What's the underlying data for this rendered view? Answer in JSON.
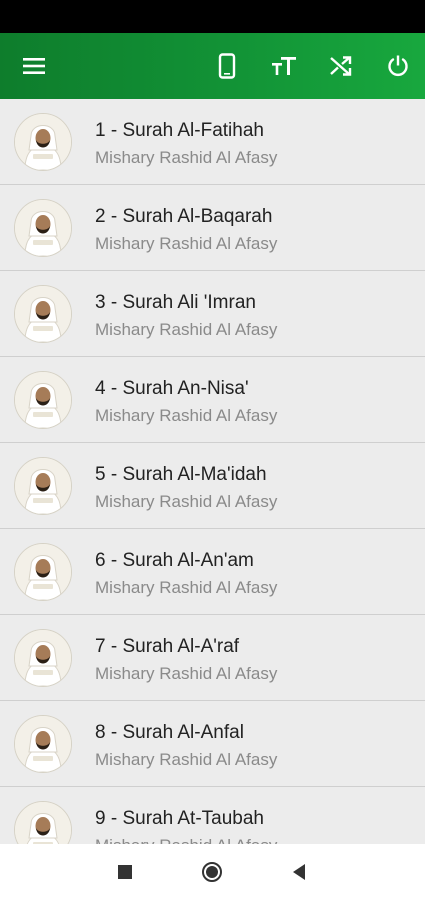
{
  "app_bar": {
    "icons": [
      "menu-icon",
      "phone-icon",
      "text-size-icon",
      "shuffle-icon",
      "power-icon"
    ],
    "color": "#129336"
  },
  "surahs": [
    {
      "title": "1 - Surah Al-Fatihah",
      "reciter": "Mishary Rashid Al Afasy"
    },
    {
      "title": "2 - Surah Al-Baqarah",
      "reciter": "Mishary Rashid Al Afasy"
    },
    {
      "title": "3 - Surah Ali 'Imran",
      "reciter": "Mishary Rashid Al Afasy"
    },
    {
      "title": "4 - Surah An-Nisa'",
      "reciter": "Mishary Rashid Al Afasy"
    },
    {
      "title": "5 - Surah Al-Ma'idah",
      "reciter": "Mishary Rashid Al Afasy"
    },
    {
      "title": "6 - Surah Al-An'am",
      "reciter": "Mishary Rashid Al Afasy"
    },
    {
      "title": "7 - Surah Al-A'raf",
      "reciter": "Mishary Rashid Al Afasy"
    },
    {
      "title": "8 - Surah Al-Anfal",
      "reciter": "Mishary Rashid Al Afasy"
    },
    {
      "title": "9 - Surah At-Taubah",
      "reciter": "Mishary Rashid Al Afasy"
    }
  ],
  "nav_bar": {
    "icons": [
      "recents-square-icon",
      "home-circle-icon",
      "back-triangle-icon"
    ]
  }
}
